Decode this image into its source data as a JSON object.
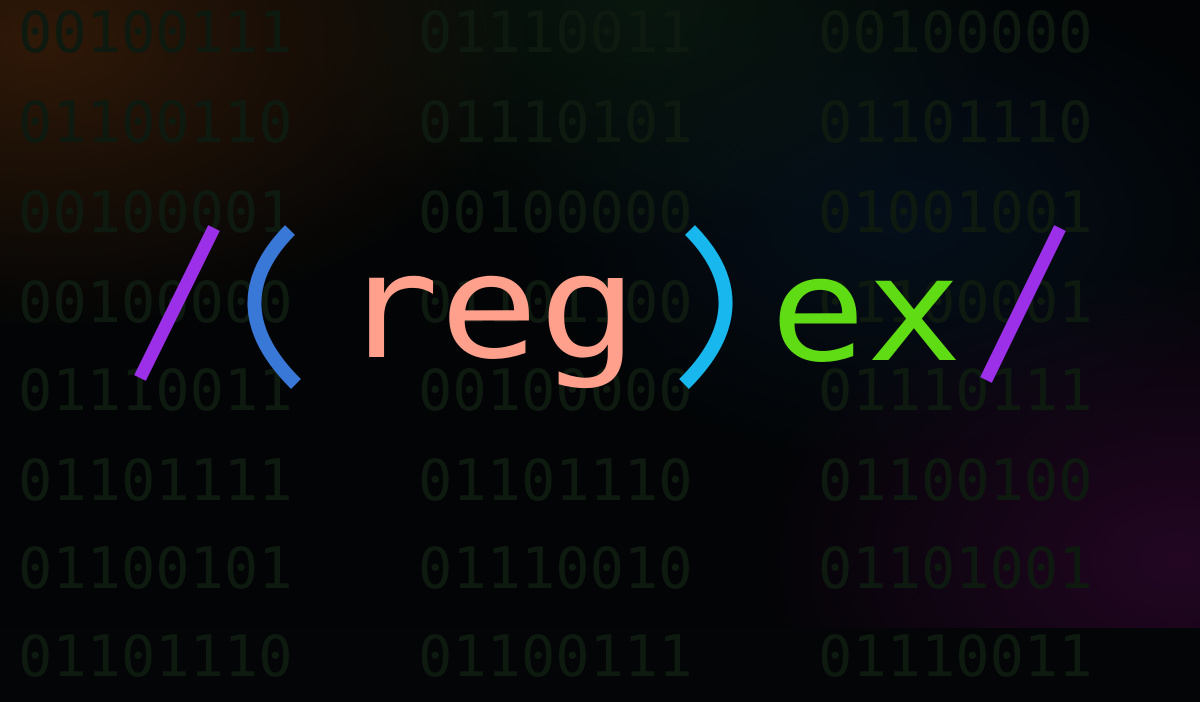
{
  "binary": [
    [
      "00100111",
      "01110011",
      "00100000"
    ],
    [
      "01100110",
      "01110101",
      "01101110"
    ],
    [
      "00100001",
      "00100000",
      "01001001"
    ],
    [
      "00100000",
      "01101100",
      "01100001"
    ],
    [
      "01110011",
      "00100000",
      "01110111"
    ],
    [
      "01101111",
      "01101110",
      "01100100"
    ],
    [
      "01100101",
      "01110010",
      "01101001"
    ],
    [
      "01101110",
      "01100111",
      "01110011"
    ]
  ],
  "logo": {
    "slash_open": "/",
    "paren_open": "(",
    "group": "reg",
    "paren_close": ")",
    "suffix": "ex",
    "slash_close": "/"
  },
  "colors": {
    "slash": "#9b30e8",
    "paren_open": "#3a78d8",
    "paren_close": "#18b8ee",
    "group": "#ffa08c",
    "suffix": "#5fdc14",
    "binary": "#0e1a10"
  }
}
